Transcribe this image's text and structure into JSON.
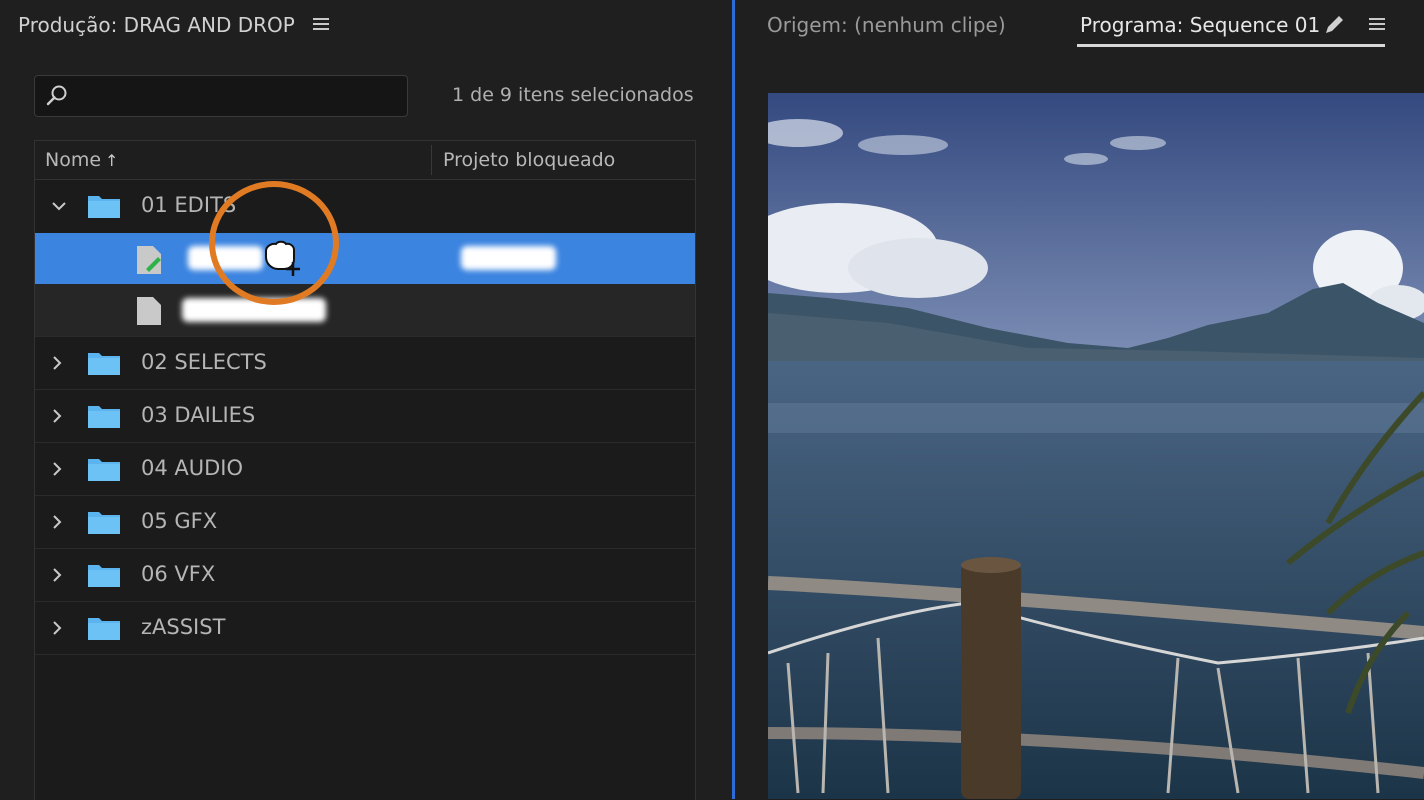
{
  "project_panel": {
    "title": "Produção: DRAG AND DROP",
    "search_placeholder": "",
    "selection_count": "1 de 9 itens selecionados",
    "columns": {
      "name": "Nome",
      "locked": "Projeto bloqueado"
    },
    "items": [
      {
        "label": "01 EDITS",
        "type": "folder",
        "expanded": true
      },
      {
        "label": "",
        "type": "sequence",
        "selected": true
      },
      {
        "label": "",
        "type": "file"
      },
      {
        "label": "02 SELECTS",
        "type": "folder"
      },
      {
        "label": "03 DAILIES",
        "type": "folder"
      },
      {
        "label": "04 AUDIO",
        "type": "folder"
      },
      {
        "label": "05 GFX",
        "type": "folder"
      },
      {
        "label": "06 VFX",
        "type": "folder"
      },
      {
        "label": "zASSIST",
        "type": "folder"
      }
    ]
  },
  "monitor_panel": {
    "source_tab": "Origem: (nenhum clipe)",
    "program_tab": "Programa: Sequence 01"
  },
  "colors": {
    "accent_blue": "#3b84e0",
    "folder_blue": "#5bb4ee",
    "cursor_ring": "#e07b24",
    "panel_bg": "#1f1f1f"
  }
}
